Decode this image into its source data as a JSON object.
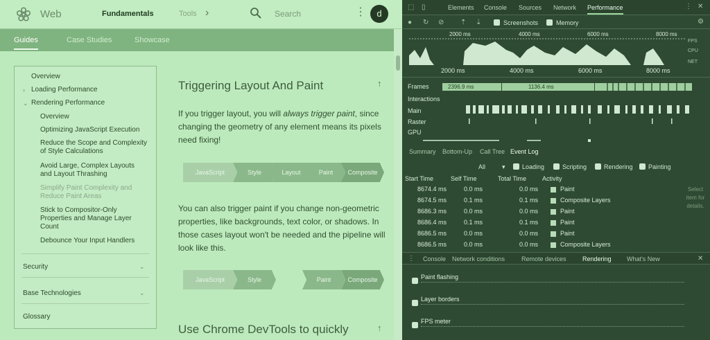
{
  "web": {
    "site_name": "Web",
    "nav": {
      "fundamentals": "Fundamentals",
      "tools": "Tools",
      "chevron": "›"
    },
    "search": {
      "placeholder": "Search"
    },
    "avatar_letter": "d",
    "subnav": [
      "Guides",
      "Case Studies",
      "Showcase"
    ]
  },
  "sidebar": {
    "items": [
      {
        "label": "Overview"
      },
      {
        "label": "Loading Performance"
      },
      {
        "label": "Rendering Performance"
      },
      {
        "label": "Overview"
      },
      {
        "label": "Optimizing JavaScript Execution"
      },
      {
        "label": "Reduce the Scope and Complexity of Style Calculations"
      },
      {
        "label": "Avoid Large, Complex Layouts and Layout Thrashing"
      },
      {
        "label": "Simplify Paint Complexity and Reduce Paint Areas"
      },
      {
        "label": "Stick to Compositor-Only Properties and Manage Layer Count"
      },
      {
        "label": "Debounce Your Input Handlers"
      }
    ],
    "sections": [
      {
        "label": "Security"
      },
      {
        "label": "Base Technologies"
      },
      {
        "label": "Glossary"
      }
    ]
  },
  "article": {
    "heading1": "Triggering Layout And Paint",
    "para1_prefix": "If you trigger layout, you will ",
    "para1_em": "always trigger paint",
    "para1_suffix": ", since changing the geometry of any element means its pixels need fixing!",
    "pipeline1": [
      "JavaScript",
      "Style",
      "Layout",
      "Paint",
      "Composite"
    ],
    "para2": "You can also trigger paint if you change non-geometric properties, like backgrounds, text color, or shadows. In those cases layout won't be needed and the pipeline will look like this.",
    "pipeline2": [
      "JavaScript",
      "Style",
      "Paint",
      "Composite"
    ],
    "heading2": "Use Chrome DevTools to quickly"
  },
  "devtools": {
    "tabs": [
      "Elements",
      "Console",
      "Sources",
      "Network",
      "Performance"
    ],
    "toolbar": {
      "screenshots": "Screenshots",
      "memory": "Memory"
    },
    "overview_ticks": [
      "2000 ms",
      "4000 ms",
      "6000 ms",
      "8000 ms"
    ],
    "overview_side": [
      "FPS",
      "CPU",
      "NET"
    ],
    "ruler_ticks": [
      "2000 ms",
      "4000 ms",
      "6000 ms",
      "8000 ms"
    ],
    "tracks": {
      "frames": "Frames",
      "interactions": "Interactions",
      "main": "Main",
      "raster": "Raster",
      "gpu": "GPU"
    },
    "frame_labels": [
      "2396.9 ms",
      "1136.4 ms"
    ],
    "subtabs": [
      "Summary",
      "Bottom-Up",
      "Call Tree",
      "Event Log"
    ],
    "filters": {
      "all": "All",
      "loading": "Loading",
      "scripting": "Scripting",
      "rendering": "Rendering",
      "painting": "Painting"
    },
    "log_headers": {
      "start": "Start Time",
      "self": "Self Time",
      "total": "Total Time",
      "activity": "Activity"
    },
    "log_rows": [
      {
        "start": "8674.4 ms",
        "self": "0.0 ms",
        "total": "0.0 ms",
        "activity": "Paint"
      },
      {
        "start": "8674.5 ms",
        "self": "0.1 ms",
        "total": "0.1 ms",
        "activity": "Composite Layers"
      },
      {
        "start": "8686.3 ms",
        "self": "0.0 ms",
        "total": "0.0 ms",
        "activity": "Paint"
      },
      {
        "start": "8686.4 ms",
        "self": "0.1 ms",
        "total": "0.1 ms",
        "activity": "Paint"
      },
      {
        "start": "8686.5 ms",
        "self": "0.0 ms",
        "total": "0.0 ms",
        "activity": "Paint"
      },
      {
        "start": "8686.5 ms",
        "self": "0.0 ms",
        "total": "0.0 ms",
        "activity": "Composite Layers"
      }
    ],
    "side_message": "Select item for details.",
    "drawer_tabs": [
      "Console",
      "Network conditions",
      "Remote devices",
      "Rendering",
      "What's New"
    ],
    "rendering": [
      "Paint flashing",
      "Layer borders",
      "FPS meter"
    ],
    "colors": {
      "panel_bg": "#2f4a33",
      "accent": "#9fd89f"
    }
  }
}
